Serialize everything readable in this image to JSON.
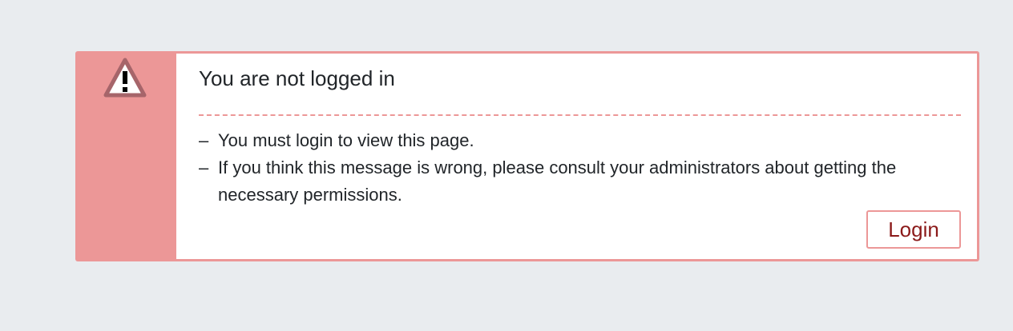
{
  "alert": {
    "icon": "warning-triangle-icon",
    "title": "You are not logged in",
    "messages": [
      "You must login to view this page.",
      "If you think this message is wrong, please consult your administrators about getting the necessary permissions."
    ],
    "bullet": "–",
    "login_label": "Login"
  },
  "colors": {
    "page_background": "#e9ecef",
    "alert_accent": "#ec9797",
    "icon_color": "#a6656a",
    "button_text": "#8b1a1a",
    "text": "#212529"
  }
}
